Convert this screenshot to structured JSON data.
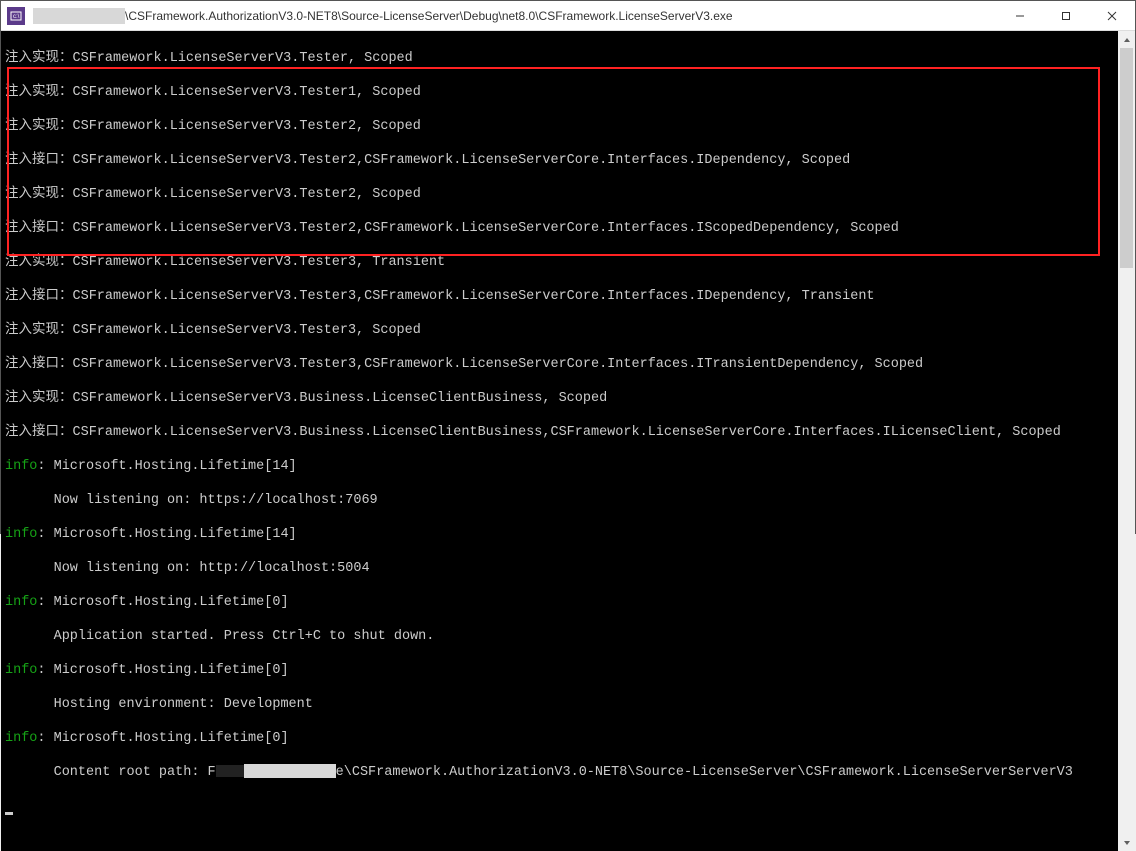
{
  "window": {
    "title_path": "\\CSFramework.AuthorizationV3.0-NET8\\Source-LicenseServer\\Debug\\net8.0\\CSFramework.LicenseServerV3.exe"
  },
  "icons": {
    "minimize": "—",
    "maximize": "☐",
    "close": "✕"
  },
  "lines": {
    "l0": "注入实现：CSFramework.LicenseServerV3.Tester, Scoped",
    "l1": "注入实现：CSFramework.LicenseServerV3.Tester1, Scoped",
    "l2": "注入实现：CSFramework.LicenseServerV3.Tester2, Scoped",
    "l3": "注入接口：CSFramework.LicenseServerV3.Tester2,CSFramework.LicenseServerCore.Interfaces.IDependency, Scoped",
    "l4": "注入实现：CSFramework.LicenseServerV3.Tester2, Scoped",
    "l5": "注入接口：CSFramework.LicenseServerV3.Tester2,CSFramework.LicenseServerCore.Interfaces.IScopedDependency, Scoped",
    "l6": "注入实现：CSFramework.LicenseServerV3.Tester3, Transient",
    "l7": "注入接口：CSFramework.LicenseServerV3.Tester3,CSFramework.LicenseServerCore.Interfaces.IDependency, Transient",
    "l8": "注入实现：CSFramework.LicenseServerV3.Tester3, Scoped",
    "l9": "注入接口：CSFramework.LicenseServerV3.Tester3,CSFramework.LicenseServerCore.Interfaces.ITransientDependency, Scoped",
    "l10": "注入实现：CSFramework.LicenseServerV3.Business.LicenseClientBusiness, Scoped",
    "l11": "注入接口：CSFramework.LicenseServerV3.Business.LicenseClientBusiness,CSFramework.LicenseServerCore.Interfaces.ILicenseClient, Scoped",
    "info_label": "info",
    "host14a": ": Microsoft.Hosting.Lifetime[14]",
    "listen_https": "      Now listening on: https://localhost:7069",
    "host14b": ": Microsoft.Hosting.Lifetime[14]",
    "listen_http": "      Now listening on: http://localhost:5004",
    "host0a": ": Microsoft.Hosting.Lifetime[0]",
    "app_started": "      Application started. Press Ctrl+C to shut down.",
    "host0b": ": Microsoft.Hosting.Lifetime[0]",
    "env": "      Hosting environment: Development",
    "host0c": ": Microsoft.Hosting.Lifetime[0]",
    "root_prefix": "      Content root path: ",
    "root_suffix_a": "e\\CSFramework.AuthorizationV3.0-NET8\\Source-LicenseServer\\CSFramework.LicenseServerServerV3",
    "root_letter": "F"
  }
}
